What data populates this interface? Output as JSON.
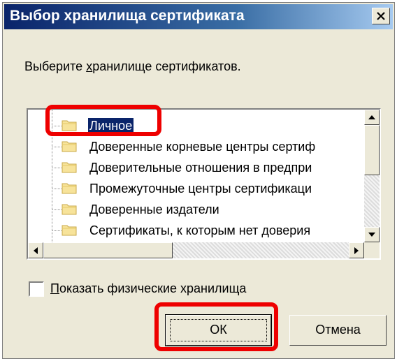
{
  "window": {
    "title": "Выбор хранилища сертификата"
  },
  "prompt": {
    "text_prefix": "Выберите ",
    "text_underline": "х",
    "text_suffix": "ранилище сертификатов."
  },
  "tree": {
    "items": [
      {
        "label": "Личное",
        "selected": true
      },
      {
        "label": "Доверенные корневые центры сертиф"
      },
      {
        "label": "Доверительные отношения в предпри"
      },
      {
        "label": "Промежуточные центры сертификаци"
      },
      {
        "label": "Доверенные издатели"
      },
      {
        "label": "Сертификаты, к которым нет доверия"
      }
    ]
  },
  "checkbox": {
    "underline_char": "П",
    "label_rest": "оказать физические хранилища",
    "checked": false
  },
  "buttons": {
    "ok_label": "ОК",
    "cancel_label": "Отмена"
  },
  "colors": {
    "highlight": "#ee0000",
    "selection": "#0a246a",
    "dialog_bg": "#ece9d8"
  },
  "icons": {
    "folder": "folder-icon",
    "close": "close-icon"
  }
}
